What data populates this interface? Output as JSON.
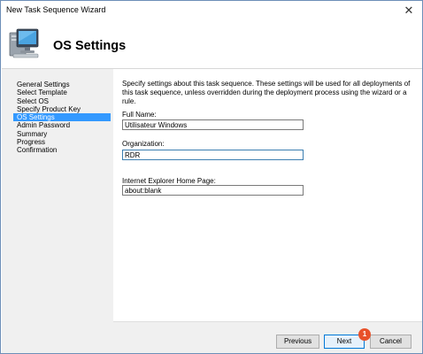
{
  "window": {
    "title": "New Task Sequence Wizard",
    "close_glyph": "✕"
  },
  "header": {
    "title": "OS Settings",
    "icon": "computer-monitor-icon"
  },
  "sidebar": {
    "items": [
      {
        "label": "General Settings",
        "active": false
      },
      {
        "label": "Select Template",
        "active": false
      },
      {
        "label": "Select OS",
        "active": false
      },
      {
        "label": "Specify Product Key",
        "active": false
      },
      {
        "label": "OS Settings",
        "active": true
      },
      {
        "label": "Admin Password",
        "active": false
      },
      {
        "label": "Summary",
        "active": false
      },
      {
        "label": "Progress",
        "active": false
      },
      {
        "label": "Confirmation",
        "active": false
      }
    ]
  },
  "main": {
    "description": "Specify settings about this task sequence.  These settings will be used for all deployments of this task sequence, unless overridden during the deployment process using the wizard or a rule.",
    "full_name": {
      "label": "Full Name:",
      "value": "Utilisateur Windows"
    },
    "organization": {
      "label": "Organization:",
      "value": "RDR"
    },
    "ie_home_page": {
      "label": "Internet Explorer Home Page:",
      "value": "about:blank"
    }
  },
  "footer": {
    "previous_label": "Previous",
    "next_label": "Next",
    "cancel_label": "Cancel",
    "badge_number": "1"
  },
  "colors": {
    "selection": "#3399ff",
    "panel": "#f0f0f0",
    "badge": "#e8512a",
    "primary_border": "#0078d7"
  }
}
